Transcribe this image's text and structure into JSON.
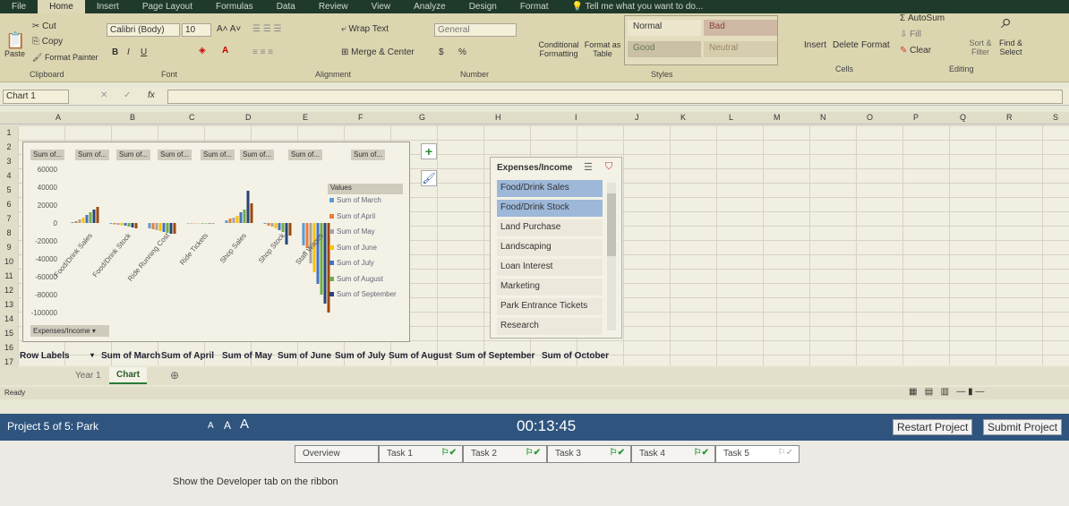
{
  "ribbon_tabs": [
    "File",
    "Home",
    "Insert",
    "Page Layout",
    "Formulas",
    "Data",
    "Review",
    "View",
    "Analyze",
    "Design",
    "Format"
  ],
  "tell_me": "Tell me what you want to do...",
  "clipboard": {
    "paste": "Paste",
    "cut": "Cut",
    "copy": "Copy",
    "format_painter": "Format Painter",
    "group": "Clipboard"
  },
  "font": {
    "name": "Calibri (Body)",
    "size": "10",
    "group": "Font",
    "bold": "B",
    "italic": "I",
    "underline": "U"
  },
  "alignment": {
    "wrap": "Wrap Text",
    "merge": "Merge & Center",
    "group": "Alignment"
  },
  "number": {
    "format": "General",
    "currency": "$",
    "percent": "%",
    "group": "Number"
  },
  "styles": {
    "conditional": "Conditional Formatting",
    "format_table": "Format as Table",
    "normal": "Normal",
    "bad": "Bad",
    "good": "Good",
    "neutral": "Neutral",
    "group": "Styles"
  },
  "cells": {
    "insert": "Insert",
    "delete": "Delete",
    "format": "Format",
    "group": "Cells"
  },
  "editing": {
    "autosum": "AutoSum",
    "fill": "Fill",
    "clear": "Clear",
    "sort": "Sort & Filter",
    "find": "Find & Select",
    "group": "Editing"
  },
  "formula_bar": {
    "name_box": "Chart 1",
    "fx": "fx",
    "value": ""
  },
  "columns": [
    "A",
    "B",
    "C",
    "D",
    "E",
    "F",
    "G",
    "H",
    "I",
    "J",
    "K",
    "L",
    "M",
    "N",
    "O",
    "P",
    "Q",
    "R",
    "S"
  ],
  "rows": [
    "1",
    "2",
    "3",
    "4",
    "5",
    "6",
    "7",
    "8",
    "9",
    "10",
    "11",
    "12",
    "13",
    "14",
    "15",
    "16",
    "17"
  ],
  "chart_data": {
    "type": "bar",
    "field_buttons": [
      "Sum of...",
      "Sum of...",
      "Sum of...",
      "Sum of...",
      "Sum of...",
      "Sum of...",
      "Sum of...",
      "Sum of..."
    ],
    "axis_field_button": "Expenses/Income",
    "categories": [
      "Food/Drink Sales",
      "Food/Drink Stock",
      "Ride Running Cost",
      "Ride Tickets",
      "Shop Sales",
      "Shop Stock",
      "Staff Wages"
    ],
    "ylim": [
      -120000,
      60000
    ],
    "yticks": [
      60000,
      40000,
      20000,
      0,
      -20000,
      -40000,
      -60000,
      -80000,
      -100000,
      -120000
    ],
    "legend_title": "Values",
    "legend_position": "right",
    "grid": false,
    "series": [
      {
        "name": "Sum of March",
        "color": "#5b9bd5",
        "values": [
          1000,
          -1000,
          -6000,
          0,
          3000,
          -1000,
          -25000
        ]
      },
      {
        "name": "Sum of April",
        "color": "#ed7d31",
        "values": [
          2000,
          -1500,
          -7000,
          0,
          5000,
          -3000,
          -28000
        ]
      },
      {
        "name": "Sum of May",
        "color": "#a5a5a5",
        "values": [
          4000,
          -2000,
          -8000,
          0,
          6000,
          -4000,
          -45000
        ]
      },
      {
        "name": "Sum of June",
        "color": "#ffc000",
        "values": [
          6000,
          -2500,
          -9000,
          0,
          8000,
          -6000,
          -55000
        ]
      },
      {
        "name": "Sum of July",
        "color": "#4472c4",
        "values": [
          9000,
          -3000,
          -10000,
          0,
          12000,
          -8000,
          -68000
        ]
      },
      {
        "name": "Sum of August",
        "color": "#70ad47",
        "values": [
          12000,
          -4000,
          -11000,
          0,
          15000,
          -10000,
          -80000
        ]
      },
      {
        "name": "Sum of September",
        "color": "#264478",
        "values": [
          15000,
          -5000,
          -12000,
          0,
          36000,
          -24000,
          -90000
        ]
      },
      {
        "name": "Sum of October",
        "color": "#9e480e",
        "values": [
          18000,
          -6000,
          -12000,
          0,
          22000,
          -14000,
          -100000
        ]
      }
    ]
  },
  "slicer": {
    "title": "Expenses/Income",
    "items": [
      {
        "label": "Food/Drink Sales",
        "selected": true
      },
      {
        "label": "Food/Drink Stock",
        "selected": true
      },
      {
        "label": "Land Purchase",
        "selected": false
      },
      {
        "label": "Landscaping",
        "selected": false
      },
      {
        "label": "Loan Interest",
        "selected": false
      },
      {
        "label": "Marketing",
        "selected": false
      },
      {
        "label": "Park Entrance Tickets",
        "selected": false
      },
      {
        "label": "Research",
        "selected": false
      }
    ]
  },
  "pivot_header": [
    "Row Labels",
    "Sum of March",
    "Sum of April",
    "Sum of May",
    "Sum of June",
    "Sum of July",
    "Sum of August",
    "Sum of September",
    "Sum of October"
  ],
  "sheet_tabs": [
    {
      "label": "Year 1",
      "active": false
    },
    {
      "label": "Chart",
      "active": true
    }
  ],
  "status": "Ready",
  "exam": {
    "project": "Project 5 of 5: Park",
    "font_sizes": [
      "A",
      "A",
      "A"
    ],
    "timer": "00:13:45",
    "restart": "Restart Project",
    "submit": "Submit Project",
    "tasks": [
      {
        "label": "Overview"
      },
      {
        "label": "Task 1",
        "done": true
      },
      {
        "label": "Task 2",
        "done": true
      },
      {
        "label": "Task 3",
        "done": true
      },
      {
        "label": "Task 4",
        "done": true
      },
      {
        "label": "Task 5",
        "done": false
      }
    ],
    "instruction": "Show the Developer tab on the ribbon"
  }
}
